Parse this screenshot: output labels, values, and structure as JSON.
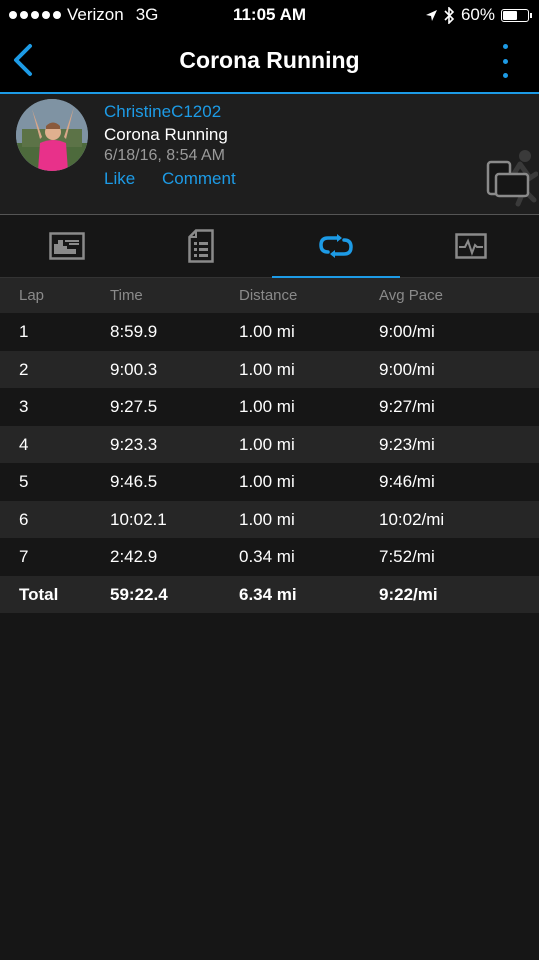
{
  "status_bar": {
    "carrier": "Verizon",
    "network": "3G",
    "time": "11:05 AM",
    "battery": "60%",
    "battery_level": 0.6
  },
  "nav": {
    "title": "Corona Running"
  },
  "activity": {
    "user": "ChristineC1202",
    "name": "Corona Running",
    "datetime": "6/18/16, 8:54 AM",
    "like_label": "Like",
    "comment_label": "Comment"
  },
  "tabs": [
    {
      "icon": "chart-icon",
      "active": false
    },
    {
      "icon": "details-list-icon",
      "active": false
    },
    {
      "icon": "laps-loop-icon",
      "active": true
    },
    {
      "icon": "heart-rate-icon",
      "active": false
    }
  ],
  "laps_table": {
    "headers": [
      "Lap",
      "Time",
      "Distance",
      "Avg Pace"
    ],
    "rows": [
      [
        "1",
        "8:59.9",
        "1.00 mi",
        "9:00/mi"
      ],
      [
        "2",
        "9:00.3",
        "1.00 mi",
        "9:00/mi"
      ],
      [
        "3",
        "9:27.5",
        "1.00 mi",
        "9:27/mi"
      ],
      [
        "4",
        "9:23.3",
        "1.00 mi",
        "9:23/mi"
      ],
      [
        "5",
        "9:46.5",
        "1.00 mi",
        "9:46/mi"
      ],
      [
        "6",
        "10:02.1",
        "1.00 mi",
        "10:02/mi"
      ],
      [
        "7",
        "2:42.9",
        "0.34 mi",
        "7:52/mi"
      ]
    ],
    "total": [
      "Total",
      "59:22.4",
      "6.34 mi",
      "9:22/mi"
    ]
  },
  "colors": {
    "accent": "#1d9be6",
    "background": "#161616",
    "row_alt": "#262626"
  }
}
